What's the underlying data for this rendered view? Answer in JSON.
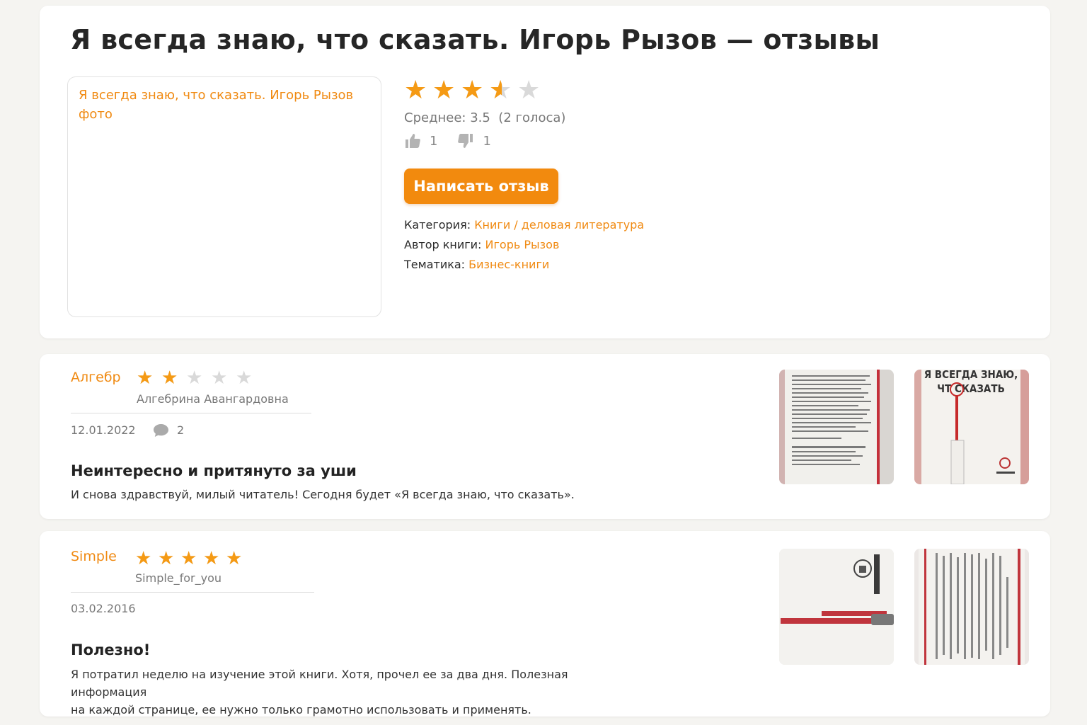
{
  "header": {
    "title": "Я всегда знаю, что сказать. Игорь Рызов — отзывы"
  },
  "product": {
    "photo_alt": "Я всегда знаю, что сказать. Игорь Рызов фото",
    "rating": 3.5,
    "rating_max": 5,
    "average_label": "Среднее: 3.5",
    "votes_label": "(2 голоса)",
    "likes": "1",
    "dislikes": "1",
    "write_review_label": "Написать отзыв",
    "meta": {
      "category_label": "Категория:",
      "category_value": "Книги / деловая литература",
      "author_label": "Автор книги:",
      "author_value": "Игорь Рызов",
      "theme_label": "Тематика:",
      "theme_value": "Бизнес-книги"
    }
  },
  "reviews": [
    {
      "author": "Алгебр",
      "username": "Алгебрина Авангардовна",
      "rating": 2,
      "date": "12.01.2022",
      "comments": "2",
      "title": "Неинтересно и притянуто за уши",
      "text": "И снова здравствуй, милый читатель! Сегодня будет «Я всегда знаю, что сказать».",
      "photos": [
        {
          "icon": "book-page-photo"
        },
        {
          "icon": "book-cover-photo",
          "cover_text_1": "Я ВСЕГДА ЗНАЮ,",
          "cover_text_2": "ЧТ СКАЗАТЬ"
        }
      ]
    },
    {
      "author": "Simple",
      "username": "Simple_for_you",
      "rating": 5,
      "date": "03.02.2016",
      "title": "Полезно!",
      "text_line1": "Я потратил неделю на изучение этой книги. Хотя, прочел ее за два дня. Полезная информация",
      "text_line2": "на каждой странице, ее нужно только грамотно использовать и применять.",
      "photos": [
        {
          "icon": "book-back-photo"
        },
        {
          "icon": "book-page-photo"
        }
      ]
    }
  ],
  "colors": {
    "accent": "#f28a0e",
    "star_filled": "#f59a14",
    "star_empty": "#d9d9d9",
    "background": "#f5f4f1"
  }
}
